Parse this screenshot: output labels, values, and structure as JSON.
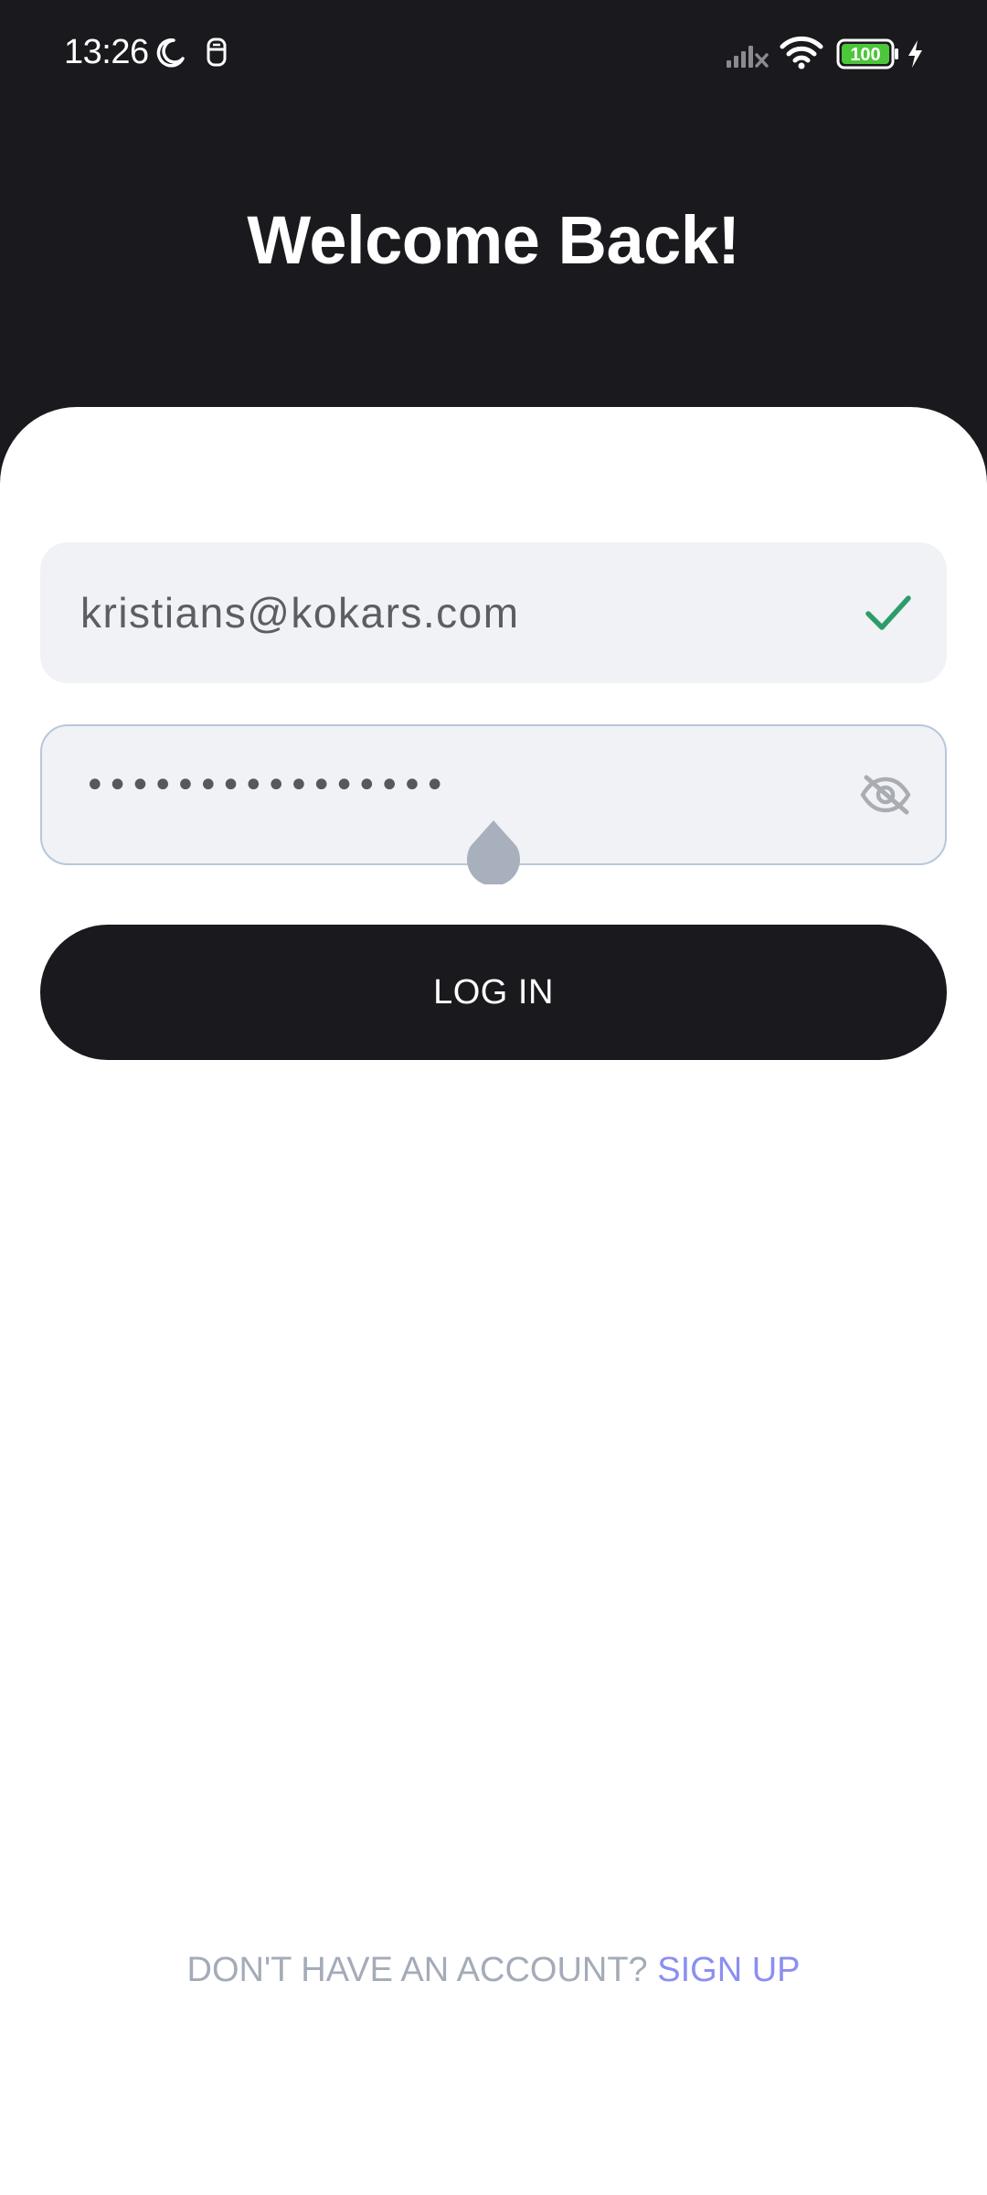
{
  "status_bar": {
    "time": "13:26",
    "battery_level": "100",
    "icons": [
      "moon-icon",
      "notification-icon",
      "signal-icon",
      "wifi-icon",
      "battery-icon",
      "charging-icon"
    ]
  },
  "header": {
    "title": "Welcome Back!"
  },
  "form": {
    "email_value": "kristians@kokars.com",
    "email_valid_icon": "check-icon",
    "password_masked": "••••••••••••••••",
    "password_toggle_icon": "eye-off-icon",
    "login_label": "LOG IN"
  },
  "footer": {
    "prompt": "DON'T HAVE AN ACCOUNT?",
    "signup_label": "SIGN UP"
  },
  "colors": {
    "background_dark": "#1a191e",
    "field_bg": "#f0f2f5",
    "check_green": "#2e9c6a",
    "link": "#8b8ef2",
    "muted": "#a4abb8"
  }
}
